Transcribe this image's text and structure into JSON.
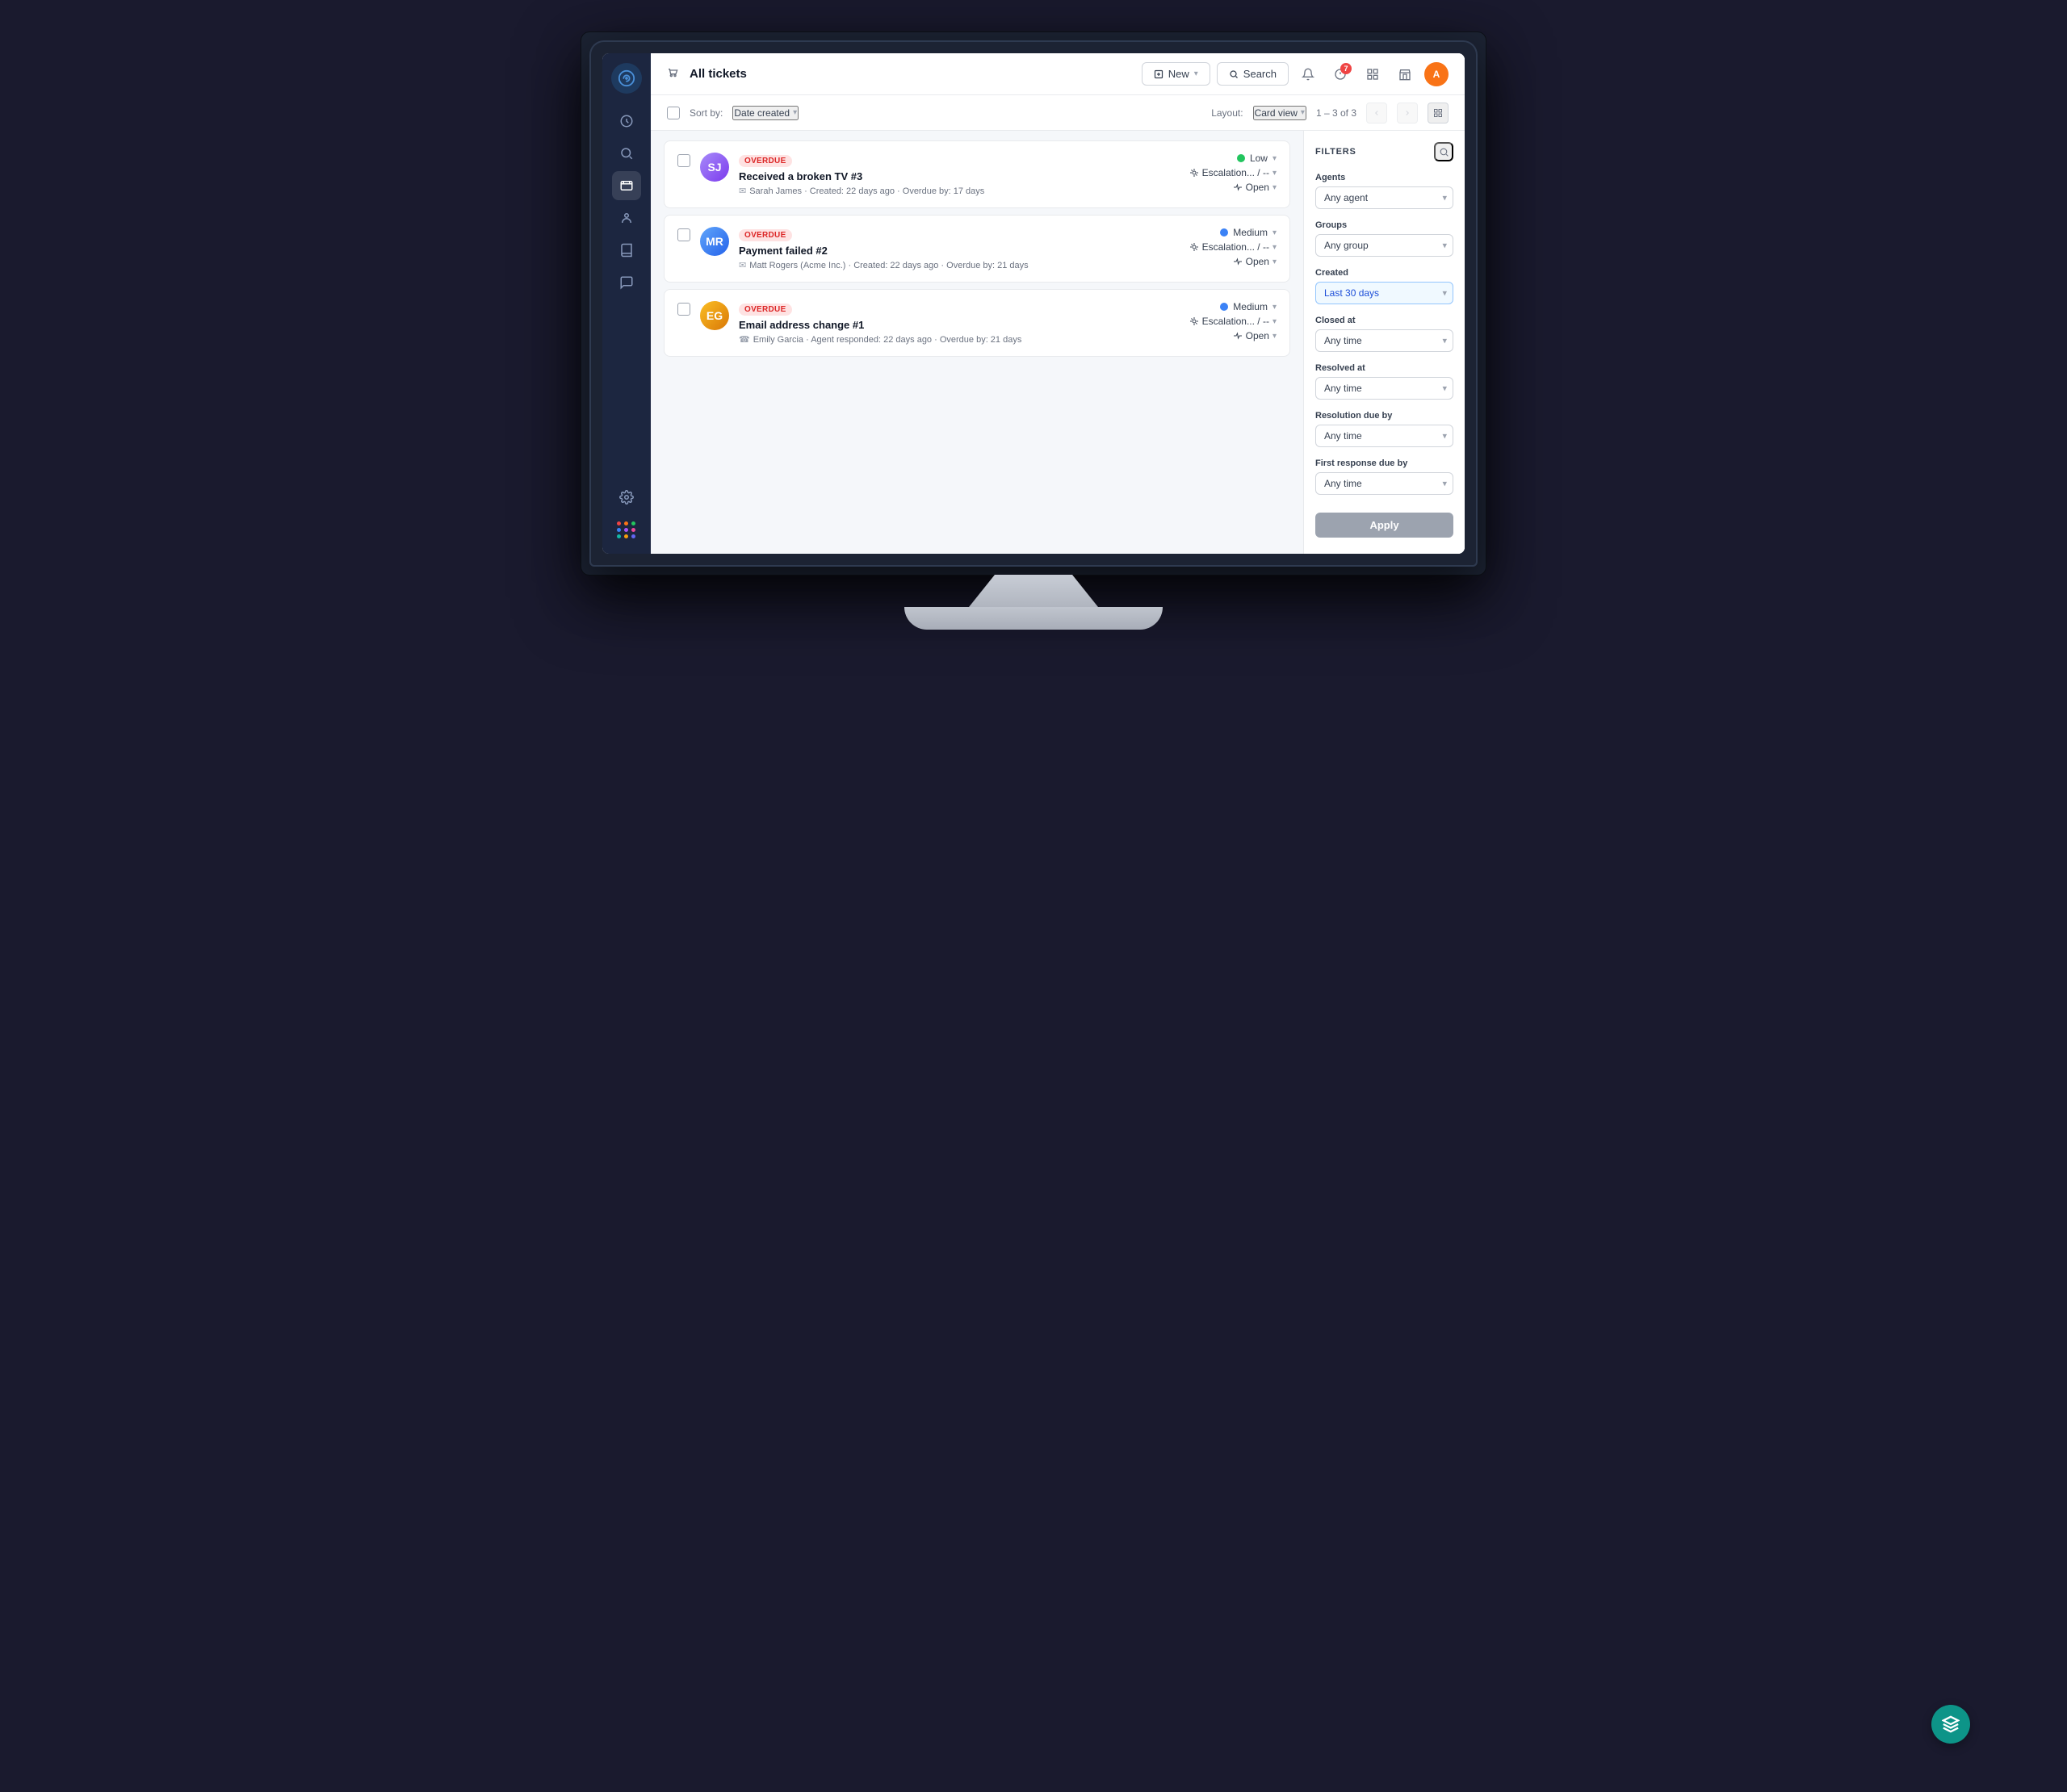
{
  "app": {
    "title": "All tickets",
    "title_icon": "tickets-icon"
  },
  "header": {
    "new_button": "New",
    "search_button": "Search",
    "user_initial": "A",
    "notification_count": "7"
  },
  "toolbar": {
    "sort_label": "Sort by:",
    "sort_value": "Date created",
    "layout_label": "Layout:",
    "layout_value": "Card view",
    "page_info": "1 – 3 of 3"
  },
  "tickets": [
    {
      "id": 1,
      "status_badge": "Overdue",
      "title": "Received a broken TV #3",
      "submitter": "Sarah James",
      "meta": "Created: 22 days ago • Overdue by: 17 days",
      "meta_icon": "email-icon",
      "priority": "Low",
      "priority_level": "low",
      "escalation": "Escalation... / --",
      "ticket_status": "Open",
      "avatar_initials": "SJ",
      "avatar_class": "avatar-sarah"
    },
    {
      "id": 2,
      "status_badge": "Overdue",
      "title": "Payment failed #2",
      "submitter": "Matt Rogers (Acme Inc.)",
      "meta": "Created: 22 days ago • Overdue by: 21 days",
      "meta_icon": "email-icon",
      "priority": "Medium",
      "priority_level": "medium",
      "escalation": "Escalation... / --",
      "ticket_status": "Open",
      "avatar_initials": "MR",
      "avatar_class": "avatar-matt"
    },
    {
      "id": 3,
      "status_badge": "Overdue",
      "title": "Email address change #1",
      "submitter": "Emily Garcia",
      "meta": "Agent responded: 22 days ago • Overdue by: 21 days",
      "meta_icon": "phone-icon",
      "priority": "Medium",
      "priority_level": "medium",
      "escalation": "Escalation... / --",
      "ticket_status": "Open",
      "avatar_initials": "EG",
      "avatar_class": "avatar-emily"
    }
  ],
  "filters": {
    "title": "FILTERS",
    "agents_label": "Agents",
    "agents_value": "Any agent",
    "groups_label": "Groups",
    "groups_value": "Any group",
    "created_label": "Created",
    "created_value": "Last 30 days",
    "closed_at_label": "Closed at",
    "closed_at_value": "Any time",
    "resolved_at_label": "Resolved at",
    "resolved_at_value": "Any time",
    "resolution_due_label": "Resolution due by",
    "resolution_due_value": "Any time",
    "first_response_label": "First response due by",
    "first_response_value": "Any time",
    "apply_button": "Apply"
  },
  "sidebar": {
    "items": [
      {
        "name": "home",
        "icon": "home-icon"
      },
      {
        "name": "search",
        "icon": "search-icon"
      },
      {
        "name": "tickets",
        "icon": "tickets-icon",
        "active": true
      },
      {
        "name": "contacts",
        "icon": "contacts-icon"
      },
      {
        "name": "knowledge",
        "icon": "book-icon"
      },
      {
        "name": "conversations",
        "icon": "chat-icon"
      },
      {
        "name": "settings",
        "icon": "settings-icon"
      }
    ]
  },
  "colors": {
    "sidebar_bg": "#1c2640",
    "sidebar_active": "rgba(255,255,255,0.12)",
    "brand_teal": "#0d9488",
    "overdue_red": "#dc2626",
    "overdue_bg": "#fee2e2",
    "priority_low": "#22c55e",
    "priority_medium": "#3b82f6"
  }
}
